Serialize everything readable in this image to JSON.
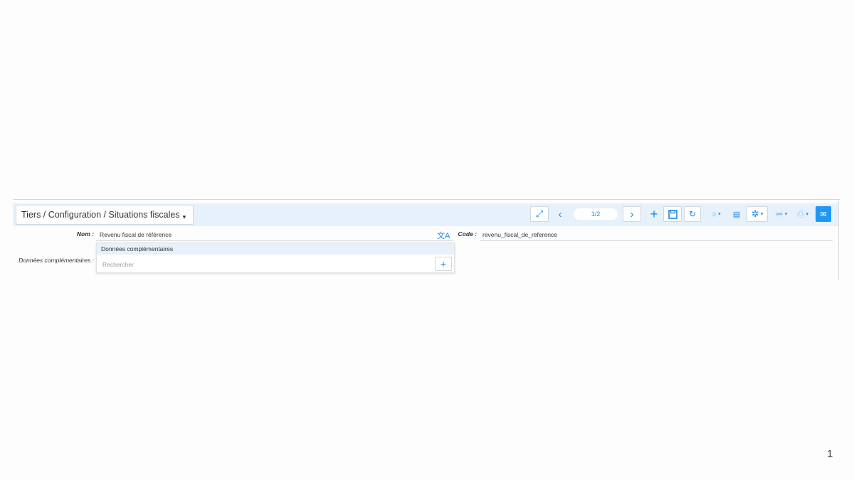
{
  "breadcrumb": {
    "text": "Tiers / Configuration / Situations fiscales"
  },
  "toolbar": {
    "page_indicator": "1/2",
    "icons": [
      "expand-icon",
      "prev-icon",
      "next-icon",
      "add-icon",
      "save-icon",
      "refresh-icon",
      "attachment-icon",
      "comment-icon",
      "settings-icon",
      "share-icon",
      "print-icon",
      "mail-icon"
    ]
  },
  "form": {
    "nom": {
      "label": "Nom :",
      "value": "Revenu fiscal de référence"
    },
    "code": {
      "label": "Code :",
      "value": "revenu_fiscal_de_reference"
    },
    "donnees": {
      "label": "Données complémentaires :",
      "panel_title": "Données complémentaires",
      "search_placeholder": "Rechercher"
    }
  },
  "footer": {
    "page_number": "1"
  },
  "colors": {
    "accent": "#1e88e5",
    "toolbar_bg": "#e6f1fb"
  }
}
